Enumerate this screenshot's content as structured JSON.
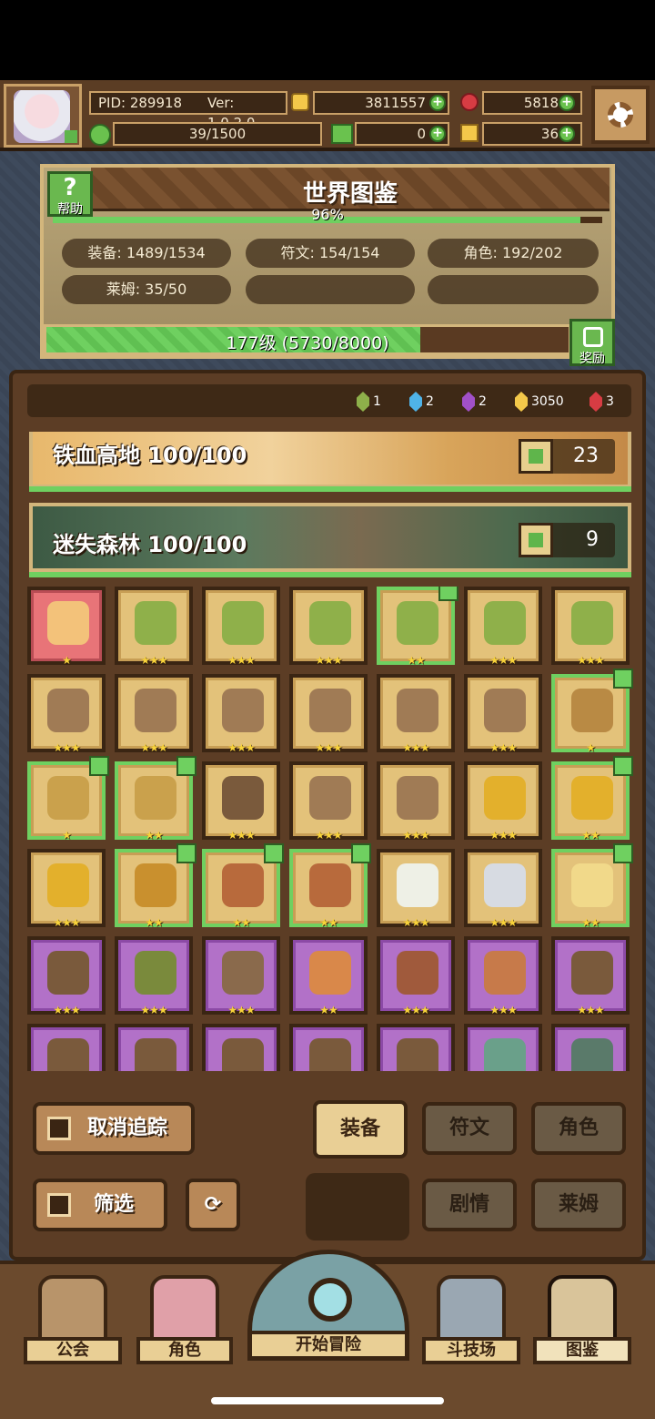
{
  "header": {
    "pid": "PID: 289918",
    "version": "Ver: 1.0.2.0",
    "gold": "3811557",
    "ruby": "5818",
    "energy": "39/1500",
    "clover": "0",
    "key": "36",
    "colors": {
      "gold": "#f3c84a",
      "ruby": "#d73c43",
      "green": "#6ac24e"
    }
  },
  "codex": {
    "title": "世界图鉴",
    "help_label": "帮助",
    "percent": "96%",
    "percent_value": 0.96,
    "stats": {
      "equipment": "装备: 1489/1534",
      "runes": "符文: 154/154",
      "characters": "角色: 192/202",
      "slime": "莱姆: 35/50"
    },
    "level_text": "177级 (5730/8000)",
    "level_progress": 0.716,
    "reward_label": "奖励"
  },
  "gems": [
    {
      "count": "1",
      "color": "#8eb04a"
    },
    {
      "count": "2",
      "color": "#4fb3e8"
    },
    {
      "count": "2",
      "color": "#a150c8"
    },
    {
      "count": "3050",
      "color": "#f3c84a"
    },
    {
      "count": "3",
      "color": "#d73c43"
    }
  ],
  "regions": [
    {
      "name": "铁血高地 100/100",
      "likes": "23"
    },
    {
      "name": "迷失森林 100/100",
      "likes": "9"
    }
  ],
  "items": [
    {
      "rarity": "red",
      "stars": "★",
      "mark": false,
      "color": "#f3c27a",
      "icon": "ring-icon"
    },
    {
      "rarity": "gold",
      "stars": "★★★",
      "mark": false,
      "color": "#8fb04a",
      "icon": "leaf-blade-icon"
    },
    {
      "rarity": "gold",
      "stars": "★★★",
      "mark": false,
      "color": "#8fb04a",
      "icon": "leaf-armor-icon"
    },
    {
      "rarity": "gold",
      "stars": "★★★",
      "mark": false,
      "color": "#8fb04a",
      "icon": "leaf-boots-icon"
    },
    {
      "rarity": "gold",
      "stars": "★★",
      "mark": true,
      "color": "#8fb04a",
      "icon": "leaf-staff-icon"
    },
    {
      "rarity": "gold",
      "stars": "★★★",
      "mark": false,
      "color": "#8fb04a",
      "icon": "leaf-ring-icon"
    },
    {
      "rarity": "gold",
      "stars": "★★★",
      "mark": false,
      "color": "#8fb04a",
      "icon": "leaf-amulet-icon"
    },
    {
      "rarity": "gold",
      "stars": "★★★",
      "mark": false,
      "color": "#a07b55",
      "icon": "bag-icon"
    },
    {
      "rarity": "gold",
      "stars": "★★★",
      "mark": false,
      "color": "#a07b55",
      "icon": "necklace-icon"
    },
    {
      "rarity": "gold",
      "stars": "★★★",
      "mark": false,
      "color": "#a07b55",
      "icon": "pot-icon"
    },
    {
      "rarity": "gold",
      "stars": "★★★",
      "mark": false,
      "color": "#a07b55",
      "icon": "bone-icon"
    },
    {
      "rarity": "gold",
      "stars": "★★★",
      "mark": false,
      "color": "#a07b55",
      "icon": "ring-icon"
    },
    {
      "rarity": "gold",
      "stars": "★★★",
      "mark": false,
      "color": "#a07b55",
      "icon": "boots-icon"
    },
    {
      "rarity": "gold",
      "stars": "★",
      "mark": true,
      "color": "#b98a44",
      "icon": "crab-icon"
    },
    {
      "rarity": "gold",
      "stars": "★",
      "mark": true,
      "color": "#caa14c",
      "icon": "robe-icon"
    },
    {
      "rarity": "gold",
      "stars": "★★",
      "mark": true,
      "color": "#caa14c",
      "icon": "mask-icon"
    },
    {
      "rarity": "gold",
      "stars": "★★★",
      "mark": false,
      "color": "#7a5a3c",
      "icon": "club-icon"
    },
    {
      "rarity": "gold",
      "stars": "★★★",
      "mark": false,
      "color": "#a07b55",
      "icon": "shell-icon"
    },
    {
      "rarity": "gold",
      "stars": "★★★",
      "mark": false,
      "color": "#a07b55",
      "icon": "shield-icon"
    },
    {
      "rarity": "gold",
      "stars": "★★★",
      "mark": false,
      "color": "#e3b02c",
      "icon": "crown-icon"
    },
    {
      "rarity": "gold",
      "stars": "★★",
      "mark": true,
      "color": "#e3b02c",
      "icon": "gold-armor-icon"
    },
    {
      "rarity": "gold",
      "stars": "★★★",
      "mark": false,
      "color": "#e3b02c",
      "icon": "gold-necklace-icon"
    },
    {
      "rarity": "gold",
      "stars": "★★",
      "mark": true,
      "color": "#c9902e",
      "icon": "wand-icon"
    },
    {
      "rarity": "gold",
      "stars": "★★",
      "mark": true,
      "color": "#b86a3c",
      "icon": "bowl-icon"
    },
    {
      "rarity": "gold",
      "stars": "★★",
      "mark": true,
      "color": "#b86a3c",
      "icon": "pendant-icon"
    },
    {
      "rarity": "gold",
      "stars": "★★★",
      "mark": false,
      "color": "#eef0e6",
      "icon": "white-armor-icon"
    },
    {
      "rarity": "gold",
      "stars": "★★★",
      "mark": false,
      "color": "#d7dbe2",
      "icon": "silver-necklace-icon"
    },
    {
      "rarity": "gold",
      "stars": "★★",
      "mark": true,
      "color": "#f1d98a",
      "icon": "star-icon"
    },
    {
      "rarity": "purple",
      "stars": "★★★",
      "mark": false,
      "color": "#7a5a3c",
      "icon": "tree-armor-icon"
    },
    {
      "rarity": "purple",
      "stars": "★★★",
      "mark": false,
      "color": "#7a8a3c",
      "icon": "tree-icon"
    },
    {
      "rarity": "purple",
      "stars": "★★★",
      "mark": false,
      "color": "#8a6a4c",
      "icon": "wood-boots-icon"
    },
    {
      "rarity": "purple",
      "stars": "★★",
      "mark": false,
      "color": "#d9884a",
      "icon": "carrot-icon"
    },
    {
      "rarity": "purple",
      "stars": "★★★",
      "mark": false,
      "color": "#a05a3c",
      "icon": "wood-ring-icon"
    },
    {
      "rarity": "purple",
      "stars": "★★★",
      "mark": false,
      "color": "#c77a4a",
      "icon": "flower-icon"
    },
    {
      "rarity": "purple",
      "stars": "★★★",
      "mark": false,
      "color": "#7a5a3c",
      "icon": "wood-shield-icon"
    },
    {
      "rarity": "purple",
      "stars": "★★★",
      "mark": false,
      "color": "#7a5a3c",
      "icon": "barrel-icon"
    },
    {
      "rarity": "purple",
      "stars": "★★★",
      "mark": false,
      "color": "#7a5a3c",
      "icon": "stump-icon"
    },
    {
      "rarity": "purple",
      "stars": "★★★",
      "mark": false,
      "color": "#7a5a3c",
      "icon": "root-icon"
    },
    {
      "rarity": "purple",
      "stars": "★★★",
      "mark": false,
      "color": "#7a5a3c",
      "icon": "vine-ring-icon"
    },
    {
      "rarity": "purple",
      "stars": "★★★",
      "mark": false,
      "color": "#7a5a3c",
      "icon": "log-icon"
    },
    {
      "rarity": "purple",
      "stars": "★★★",
      "mark": false,
      "color": "#6aa08a",
      "icon": "sword-icon"
    },
    {
      "rarity": "purple",
      "stars": "★★★",
      "mark": false,
      "color": "#5a7a6a",
      "icon": "axe-icon"
    }
  ],
  "buttons": {
    "untrack": "取消追踪",
    "filter": "筛选",
    "equipment": "装备",
    "runes": "符文",
    "characters": "角色",
    "story": "剧情",
    "slime": "莱姆"
  },
  "nav": {
    "guild": "公会",
    "characters": "角色",
    "adventure": "开始冒险",
    "arena": "斗技场",
    "codex": "图鉴"
  }
}
